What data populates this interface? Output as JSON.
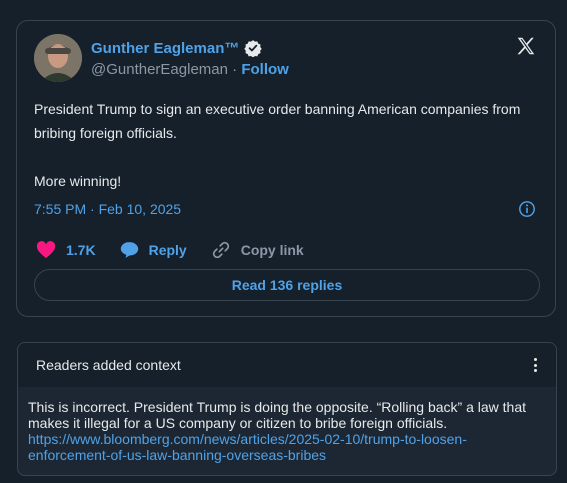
{
  "tweet": {
    "author_name": "Gunther Eagleman™",
    "handle": "@GuntherEagleman",
    "separator": "·",
    "follow_label": "Follow",
    "text_line1": "President Trump to sign an executive order banning American companies from bribing foreign officials.",
    "text_line2": "More winning!",
    "timestamp": "7:55 PM · Feb 10, 2025",
    "like_count": "1.7K",
    "reply_label": "Reply",
    "copy_link_label": "Copy link",
    "read_replies_label": "Read 136 replies"
  },
  "context": {
    "header": "Readers added context",
    "body": "This is incorrect. President Trump is doing the opposite. “Rolling back” a law that makes it illegal for a US company or citizen to bribe foreign officials.",
    "link": "https://www.bloomberg.com/news/articles/2025-02-10/trump-to-loosen-enforcement-of-us-law-banning-overseas-bribes"
  },
  "colors": {
    "background": "#15202b",
    "accent": "#4fa2e8",
    "like": "#f91880",
    "border": "#38444d",
    "muted": "#8b98a5"
  },
  "icons": [
    "avatar",
    "verified-badge-icon",
    "x-logo-icon",
    "info-icon",
    "heart-icon",
    "reply-bubble-icon",
    "link-icon",
    "more-vertical-icon"
  ]
}
